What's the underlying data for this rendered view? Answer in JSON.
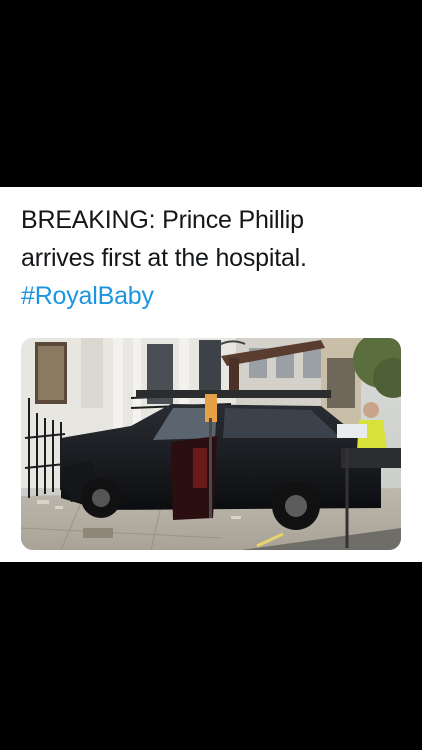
{
  "tweet": {
    "line1": "BREAKING: Prince Phillip",
    "line2": "arrives first at the hospital.",
    "hashtag": "#RoyalBaby",
    "hashtag_color": "#1b95e0"
  },
  "photo": {
    "subject": "crashed black SUV against railings on a London street"
  },
  "colors": {
    "background": "#000000",
    "card": "#ffffff",
    "text": "#14171a"
  }
}
